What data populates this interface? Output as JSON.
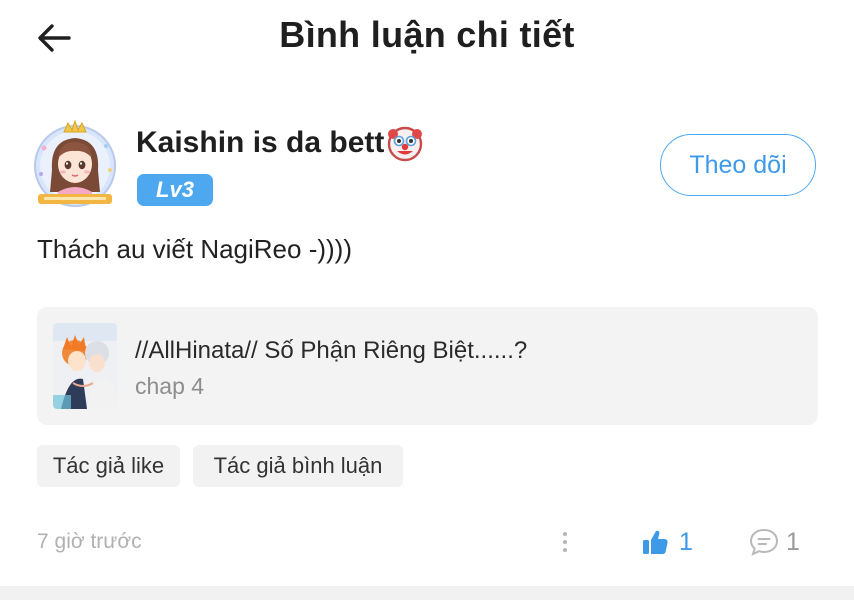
{
  "header": {
    "title": "Bình luận chi tiết",
    "back_icon": "arrow-left-icon"
  },
  "author": {
    "name": "Kaishin is da bett",
    "name_emoji": "clown-face",
    "level": "Lv3",
    "avatar_icon": "anime-girl-avatar"
  },
  "follow_button": {
    "label": "Theo dõi"
  },
  "comment": {
    "text": "Thách au viết NagiReo -))))"
  },
  "story": {
    "title": "//AllHinata// Số Phận Riêng Biệt......?",
    "subtitle": "chap 4",
    "cover_icon": "manga-cover-thumbnail"
  },
  "tags": [
    {
      "label": "Tác giả like"
    },
    {
      "label": "Tác giả bình luận"
    }
  ],
  "footer": {
    "time": "7 giờ trước",
    "like_count": "1",
    "reply_count": "1"
  },
  "colors": {
    "accent": "#4ea8f0",
    "text": "#1f1f1f",
    "muted": "#b1b1b1",
    "card_bg": "#f3f3f3"
  }
}
